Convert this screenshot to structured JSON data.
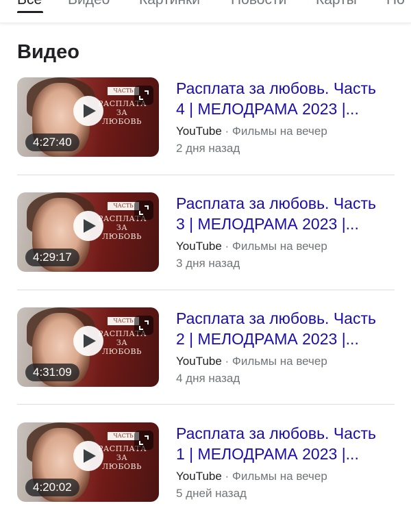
{
  "tabs": [
    {
      "label": "Все",
      "active": true
    },
    {
      "label": "Видео",
      "active": false
    },
    {
      "label": "Картинки",
      "active": false
    },
    {
      "label": "Новости",
      "active": false
    },
    {
      "label": "Карты",
      "active": false
    },
    {
      "label": "По",
      "active": false
    }
  ],
  "section_title": "Видео",
  "poster": {
    "badge": "ЧАСТЬ",
    "title_lines": [
      "РАСПЛАТА",
      "ЗА",
      "ЛЮБОВЬ"
    ]
  },
  "results": [
    {
      "title_line1": "Расплата за любовь. Часть",
      "title_line2": "4 | МЕЛОДРАМА 2023 |...",
      "source": "YouTube",
      "separator": " · ",
      "channel": "Фильмы на вечер",
      "date": "2 дня назад",
      "duration": "4:27:40"
    },
    {
      "title_line1": "Расплата за любовь. Часть",
      "title_line2": "3 | МЕЛОДРАМА 2023 |...",
      "source": "YouTube",
      "separator": " · ",
      "channel": "Фильмы на вечер",
      "date": "3 дня назад",
      "duration": "4:29:17"
    },
    {
      "title_line1": "Расплата за любовь. Часть",
      "title_line2": "2 | МЕЛОДРАМА 2023 |...",
      "source": "YouTube",
      "separator": " · ",
      "channel": "Фильмы на вечер",
      "date": "4 дня назад",
      "duration": "4:31:09"
    },
    {
      "title_line1": "Расплата за любовь. Часть",
      "title_line2": "1 | МЕЛОДРАМА 2023 |...",
      "source": "YouTube",
      "separator": " · ",
      "channel": "Фильмы на вечер",
      "date": "5 дней назад",
      "duration": "4:20:02"
    }
  ],
  "icons": {
    "play": "play-icon",
    "expand": "expand-icon"
  },
  "colors": {
    "link": "#1a0dab",
    "text": "#202124",
    "secondary": "#70757a",
    "divider": "#dadce0"
  }
}
